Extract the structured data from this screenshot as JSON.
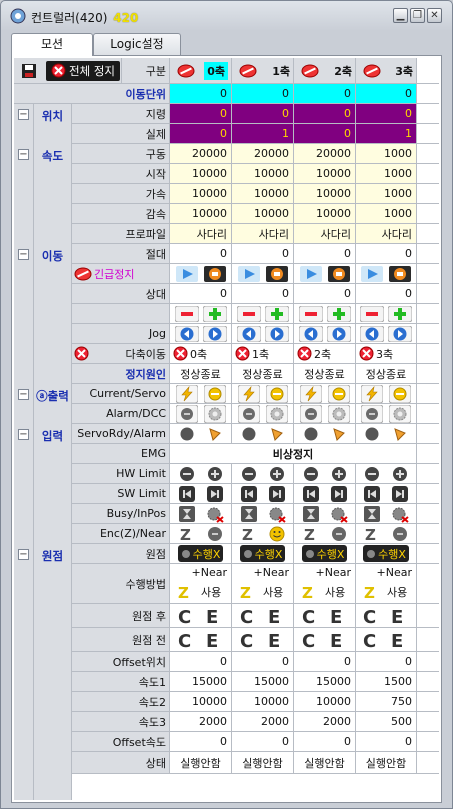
{
  "window": {
    "title": "컨트럴러(420)",
    "title_num": "420"
  },
  "tabs": [
    {
      "label": "모션"
    },
    {
      "label": "Logic설정"
    }
  ],
  "header": {
    "estop_label": "전체 정지",
    "col_label": "구분",
    "axes": [
      "0축",
      "1축",
      "2축",
      "3축"
    ]
  },
  "categories": {
    "pos": "위치",
    "speed": "속도",
    "move": "이동",
    "output": "출력",
    "output_prefix": "ⓐ",
    "input": "입력",
    "origin": "원점"
  },
  "rows": {
    "unit": {
      "label": "이동단위",
      "values": [
        "0",
        "0",
        "0",
        "0"
      ]
    },
    "cmd": {
      "label": "지령",
      "values": [
        "0",
        "0",
        "0",
        "0"
      ]
    },
    "act": {
      "label": "실제",
      "values": [
        "0",
        "1",
        "0",
        "1"
      ]
    },
    "drive": {
      "label": "구동",
      "values": [
        "20000",
        "20000",
        "20000",
        "1000"
      ]
    },
    "start": {
      "label": "시작",
      "values": [
        "10000",
        "10000",
        "10000",
        "1000"
      ]
    },
    "accel": {
      "label": "가속",
      "values": [
        "10000",
        "10000",
        "10000",
        "1000"
      ]
    },
    "decel": {
      "label": "감속",
      "values": [
        "10000",
        "10000",
        "10000",
        "1000"
      ]
    },
    "profile": {
      "label": "프로파일",
      "values": [
        "사다리",
        "사다리",
        "사다리",
        "사다리"
      ]
    },
    "abs": {
      "label": "절대",
      "values": [
        "0",
        "0",
        "0",
        "0"
      ]
    },
    "estop2": {
      "label": "긴급정지"
    },
    "rel": {
      "label": "상대",
      "values": [
        "0",
        "0",
        "0",
        "0"
      ]
    },
    "jog": {
      "label": "Jog"
    },
    "multi": {
      "label": "다축이동",
      "values": [
        "0축",
        "1축",
        "2축",
        "3축"
      ]
    },
    "stopcause": {
      "label": "정지원인",
      "values": [
        "정상종료",
        "정상종료",
        "정상종료",
        "정상종료"
      ]
    },
    "curservo": {
      "label": "Current/Servo"
    },
    "alarmdcc": {
      "label": "Alarm/DCC"
    },
    "servordy": {
      "label": "ServoRdy/Alarm"
    },
    "emg": {
      "label": "EMG",
      "value": "비상정지"
    },
    "hwlimit": {
      "label": "HW Limit"
    },
    "swlimit": {
      "label": "SW Limit"
    },
    "busy": {
      "label": "Busy/InPos"
    },
    "enc": {
      "label": "Enc(Z)/Near"
    },
    "origin": {
      "label": "원점",
      "values": [
        "수행X",
        "수행X",
        "수행X",
        "수행X"
      ]
    },
    "method": {
      "label": "수행방법",
      "values": [
        "+Near",
        "+Near",
        "+Near",
        "+Near"
      ]
    },
    "use": {
      "values": [
        "사용",
        "사용",
        "사용",
        "사용"
      ]
    },
    "after": {
      "label": "원점 후"
    },
    "before": {
      "label": "원점 전"
    },
    "offpos": {
      "label": "Offset위치",
      "values": [
        "0",
        "0",
        "0",
        "0"
      ]
    },
    "spd1": {
      "label": "속도1",
      "values": [
        "15000",
        "15000",
        "15000",
        "1500"
      ]
    },
    "spd2": {
      "label": "속도2",
      "values": [
        "10000",
        "10000",
        "10000",
        "750"
      ]
    },
    "spd3": {
      "label": "속도3",
      "values": [
        "2000",
        "2000",
        "2000",
        "500"
      ]
    },
    "offspd": {
      "label": "Offset속도",
      "values": [
        "0",
        "0",
        "0",
        "0"
      ]
    },
    "state": {
      "label": "상태",
      "values": [
        "실행안함",
        "실행안함",
        "실행안함",
        "실행안함"
      ]
    }
  },
  "colors": {
    "cyan": "#00ffff",
    "purple": "#800080",
    "yellow_bg": "#fffde0",
    "label_bg": "#dadde2",
    "accent_text": "#1a2fb0"
  }
}
